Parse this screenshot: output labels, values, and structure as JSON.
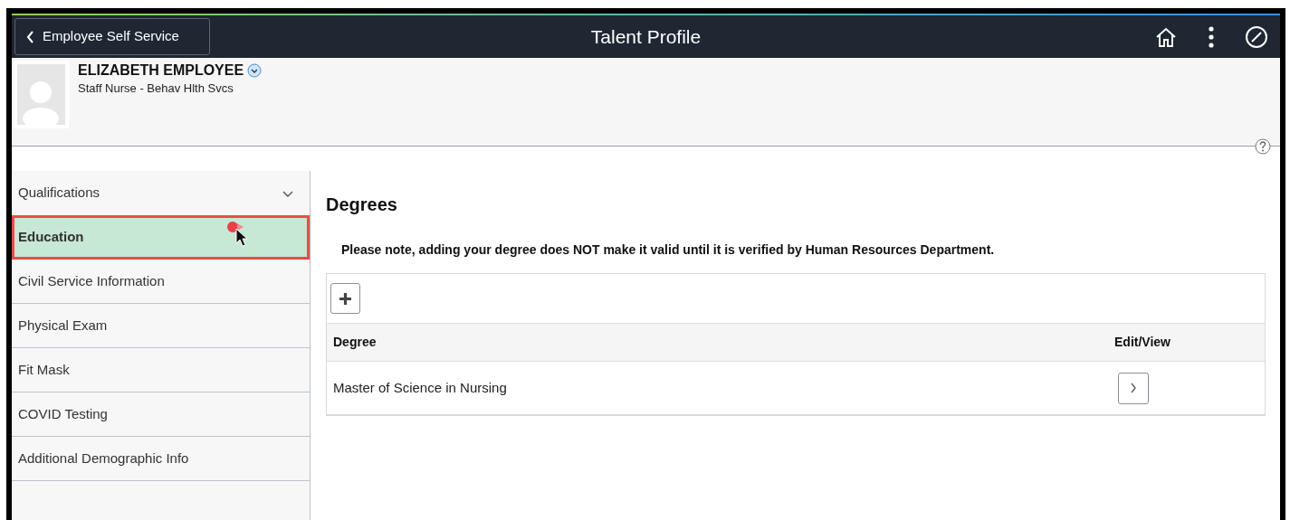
{
  "header": {
    "back_button": "Employee Self Service",
    "title": "Talent Profile"
  },
  "profile": {
    "name": "ELIZABETH EMPLOYEE",
    "job_title": "Staff Nurse - Behav Hlth Svcs"
  },
  "sidebar": {
    "items": [
      {
        "kind": "group",
        "label": "Qualifications",
        "expanded": true,
        "selected": false
      },
      {
        "kind": "item",
        "label": "Education",
        "selected": true
      },
      {
        "kind": "item",
        "label": "Civil Service Information",
        "selected": false
      },
      {
        "kind": "item",
        "label": "Physical Exam",
        "selected": false
      },
      {
        "kind": "item",
        "label": "Fit Mask",
        "selected": false
      },
      {
        "kind": "item",
        "label": "COVID Testing",
        "selected": false
      },
      {
        "kind": "item",
        "label": "Additional Demographic Info",
        "selected": false
      }
    ]
  },
  "main": {
    "title": "Degrees",
    "note": "Please note, adding your degree does NOT make it valid until it is verified by Human Resources Department.",
    "table": {
      "columns": [
        "Degree",
        "Edit/View"
      ],
      "rows": [
        {
          "degree": "Master of Science in Nursing"
        }
      ]
    }
  }
}
